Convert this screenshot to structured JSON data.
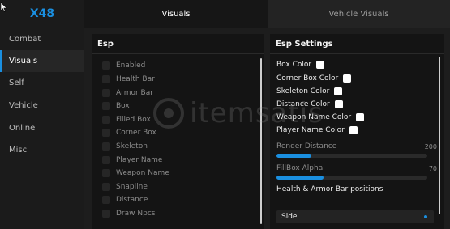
{
  "brand": "X48",
  "accent_color": "#1a8fe0",
  "tabs": [
    {
      "label": "Visuals",
      "active": true
    },
    {
      "label": "Vehicle Visuals",
      "active": false
    }
  ],
  "sidebar": {
    "items": [
      {
        "label": "Combat",
        "active": false
      },
      {
        "label": "Visuals",
        "active": true
      },
      {
        "label": "Self",
        "active": false
      },
      {
        "label": "Vehicle",
        "active": false
      },
      {
        "label": "Online",
        "active": false
      },
      {
        "label": "Misc",
        "active": false
      }
    ]
  },
  "esp": {
    "title": "Esp",
    "items": [
      "Enabled",
      "Health Bar",
      "Armor Bar",
      "Box",
      "Filled Box",
      "Corner Box",
      "Skeleton",
      "Player Name",
      "Weapon Name",
      "Snapline",
      "Distance",
      "Draw Npcs"
    ]
  },
  "settings": {
    "title": "Esp Settings",
    "colors": [
      "Box Color",
      "Corner Box Color",
      "Skeleton Color",
      "Distance Color",
      "Weapon Name Color",
      "Player Name Color"
    ],
    "sliders": [
      {
        "label": "Render Distance",
        "value": "200",
        "fill_fraction": 0.23
      },
      {
        "label": "FillBox Alpha",
        "value": "70",
        "fill_fraction": 0.31
      }
    ],
    "positions_label": "Health & Armor Bar positions",
    "dropdown_value": "Side"
  },
  "watermark": "itemsatis"
}
